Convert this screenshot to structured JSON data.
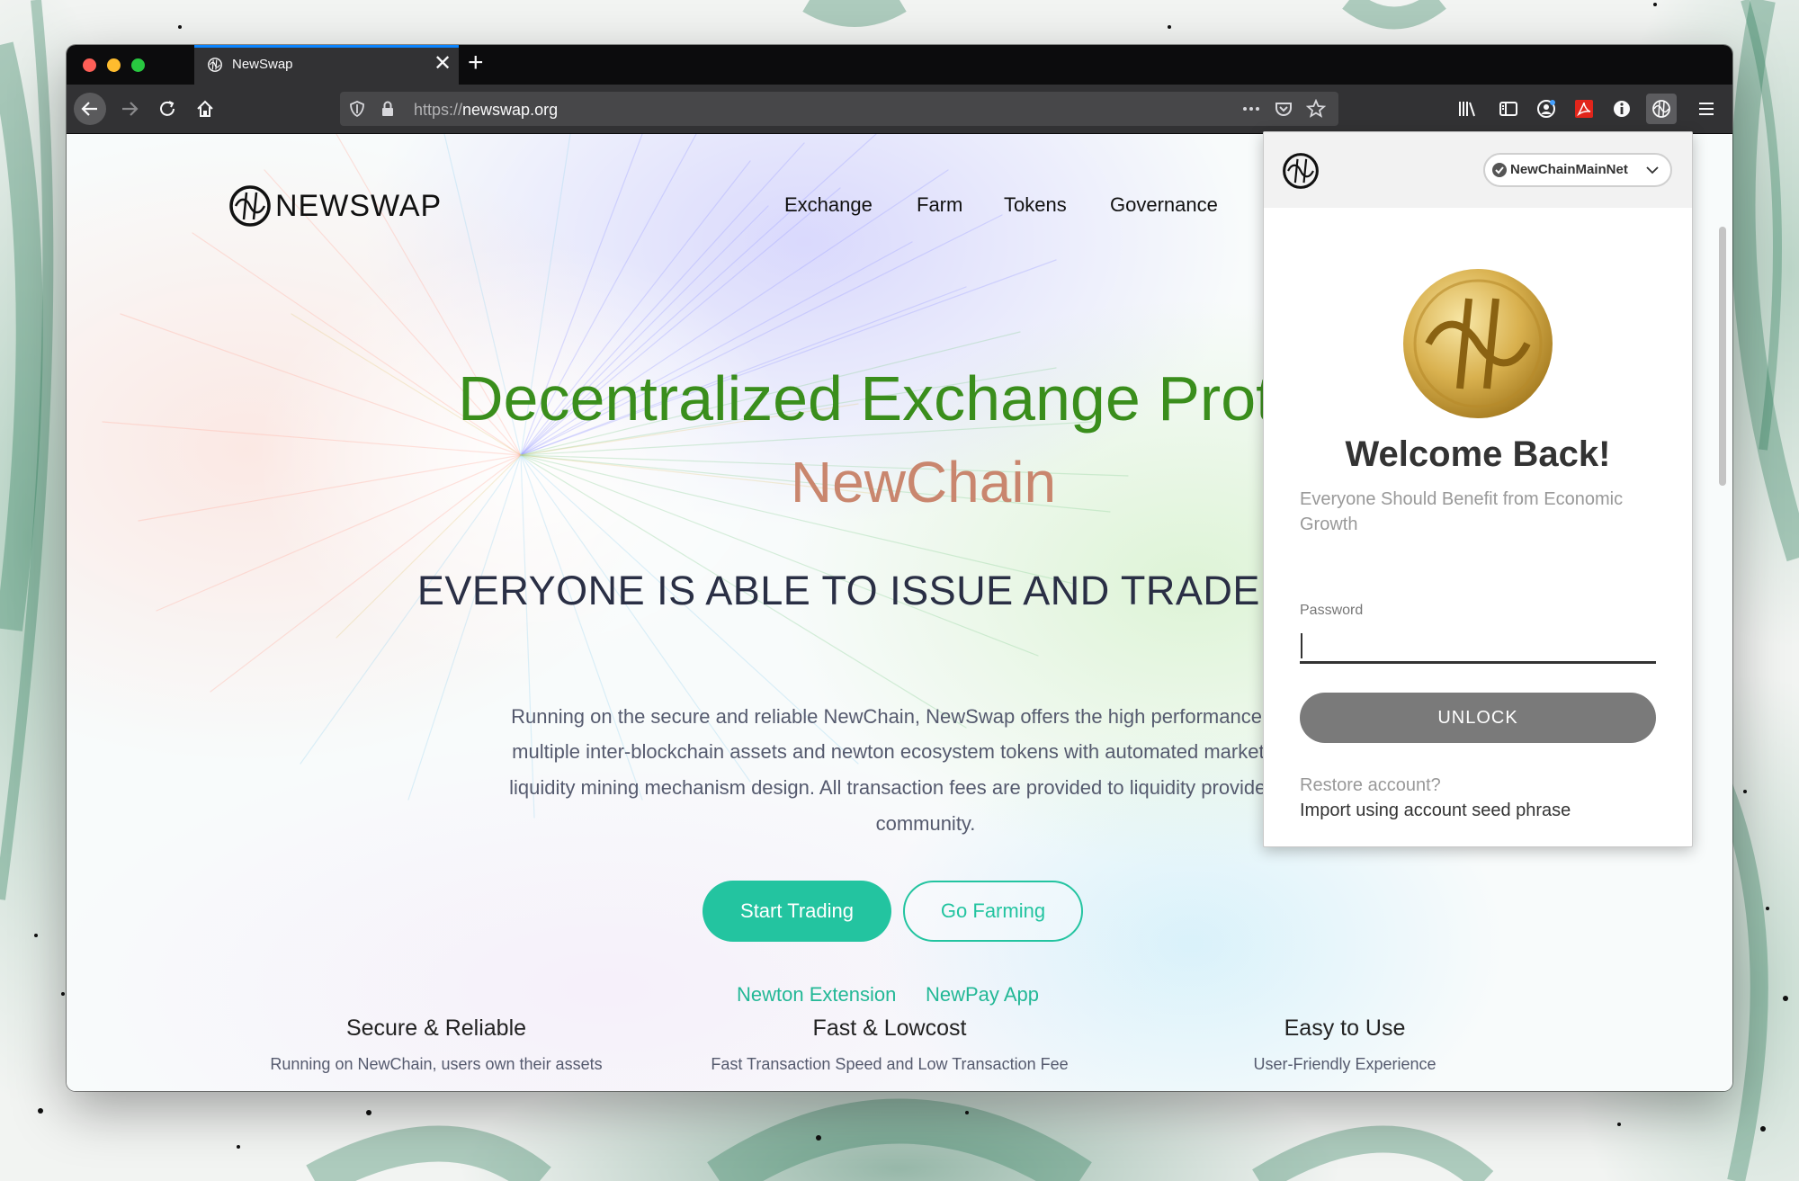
{
  "browser": {
    "tab_title": "NewSwap",
    "url_scheme": "https://",
    "url_host": "newswap.org"
  },
  "site": {
    "logo_text": "NEWSWAP",
    "nav": [
      "Exchange",
      "Farm",
      "Tokens",
      "Governance"
    ],
    "hero_title": "Decentralized Exchange Protocol",
    "hero_subtitle": "NewChain",
    "tagline": "EVERYONE IS ABLE TO ISSUE AND TRADE DIGITAL",
    "description_lines": [
      "Running on the secure and reliable NewChain, NewSwap offers the high performance and low",
      "multiple inter-blockchain assets and newton ecosystem tokens with automated market makers",
      "liquidity mining mechanism design. All transaction fees are provided to liquidity providers and g",
      "community."
    ],
    "primary_button": "Start Trading",
    "secondary_button": "Go Farming",
    "links": [
      "Newton Extension",
      "NewPay App"
    ],
    "features": [
      {
        "title": "Secure & Reliable",
        "desc": "Running on NewChain, users own their assets"
      },
      {
        "title": "Fast & Lowcost",
        "desc": "Fast Transaction Speed and Low Transaction Fee"
      },
      {
        "title": "Easy to Use",
        "desc": "User-Friendly Experience"
      }
    ],
    "colors": {
      "accent": "#23c4a0",
      "hero_title": "#3a8e1c",
      "hero_subtitle": "#c9866e"
    }
  },
  "popup": {
    "network": "NewChainMainNet",
    "welcome": "Welcome Back!",
    "subtitle": "Everyone Should Benefit from Economic Growth",
    "password_label": "Password",
    "password_value": "",
    "unlock_button": "UNLOCK",
    "restore_question": "Restore account?",
    "restore_link": "Import using account seed phrase"
  }
}
